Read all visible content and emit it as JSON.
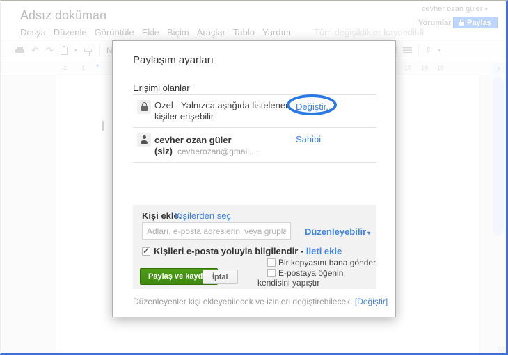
{
  "colors": {
    "frame_blue": "#4070d4",
    "link_blue": "#4184e4",
    "annotation_blue": "#2a78e4",
    "share_button_blue": "#4d90fe",
    "green_button": "#469623"
  },
  "icons": {
    "star": "☆",
    "dropdown_arrow": "▾",
    "undo": "↶",
    "redo": "↷",
    "checkmark": "✓",
    "scroll_up_arrow": "∧",
    "line_spacing_arrow": "⇕"
  },
  "header": {
    "doc_title": "Adsız doküman",
    "account_name": "cevher ozan güler",
    "comments_label": "Yorumlar",
    "share_label": "Paylaş"
  },
  "menubar": {
    "items": [
      "Dosya",
      "Düzenle",
      "Görüntüle",
      "Ekle",
      "Biçim",
      "Araçlar",
      "Tablo",
      "Yardım"
    ],
    "status": "Tüm değişiklikler kaydedildi"
  },
  "toolbar": {
    "style_label": "Norma"
  },
  "ruler": {
    "left_numbers": [
      "2",
      "1"
    ],
    "right_numbers": [
      "17",
      "18",
      "19"
    ]
  },
  "dialog": {
    "title": "Paylaşım ayarları",
    "access": {
      "heading": "Erişimi olanlar",
      "private_text": "Özel - Yalnızca aşağıda listelenen kişiler erişebilir",
      "private_action": "Değiştir...",
      "owner_name": "cevher ozan güler (siz)",
      "owner_email": "cevherozan@gmail....",
      "owner_action": "Sahibi"
    },
    "invite": {
      "label": "Kişi ekle:",
      "choose_link": "Kişilerden seç",
      "placeholder": "Adları, e-posta adreslerini veya grupları girin...",
      "permission_label": "Düzenleyebilir",
      "notify_label": "Kişileri e-posta yoluyla bilgilendir -",
      "notify_link": "İleti ekle",
      "copy_label": "Bir kopyasını bana gönder",
      "paste_label": "E-postaya öğenin kendisini yapıştır",
      "submit_label": "Paylaş ve kaydet",
      "cancel_label": "İptal"
    },
    "footer": {
      "text": "Düzenleyenler kişi ekleyebilecek ve izinleri değiştirebilecek.",
      "link": "[Değiştir]"
    }
  }
}
